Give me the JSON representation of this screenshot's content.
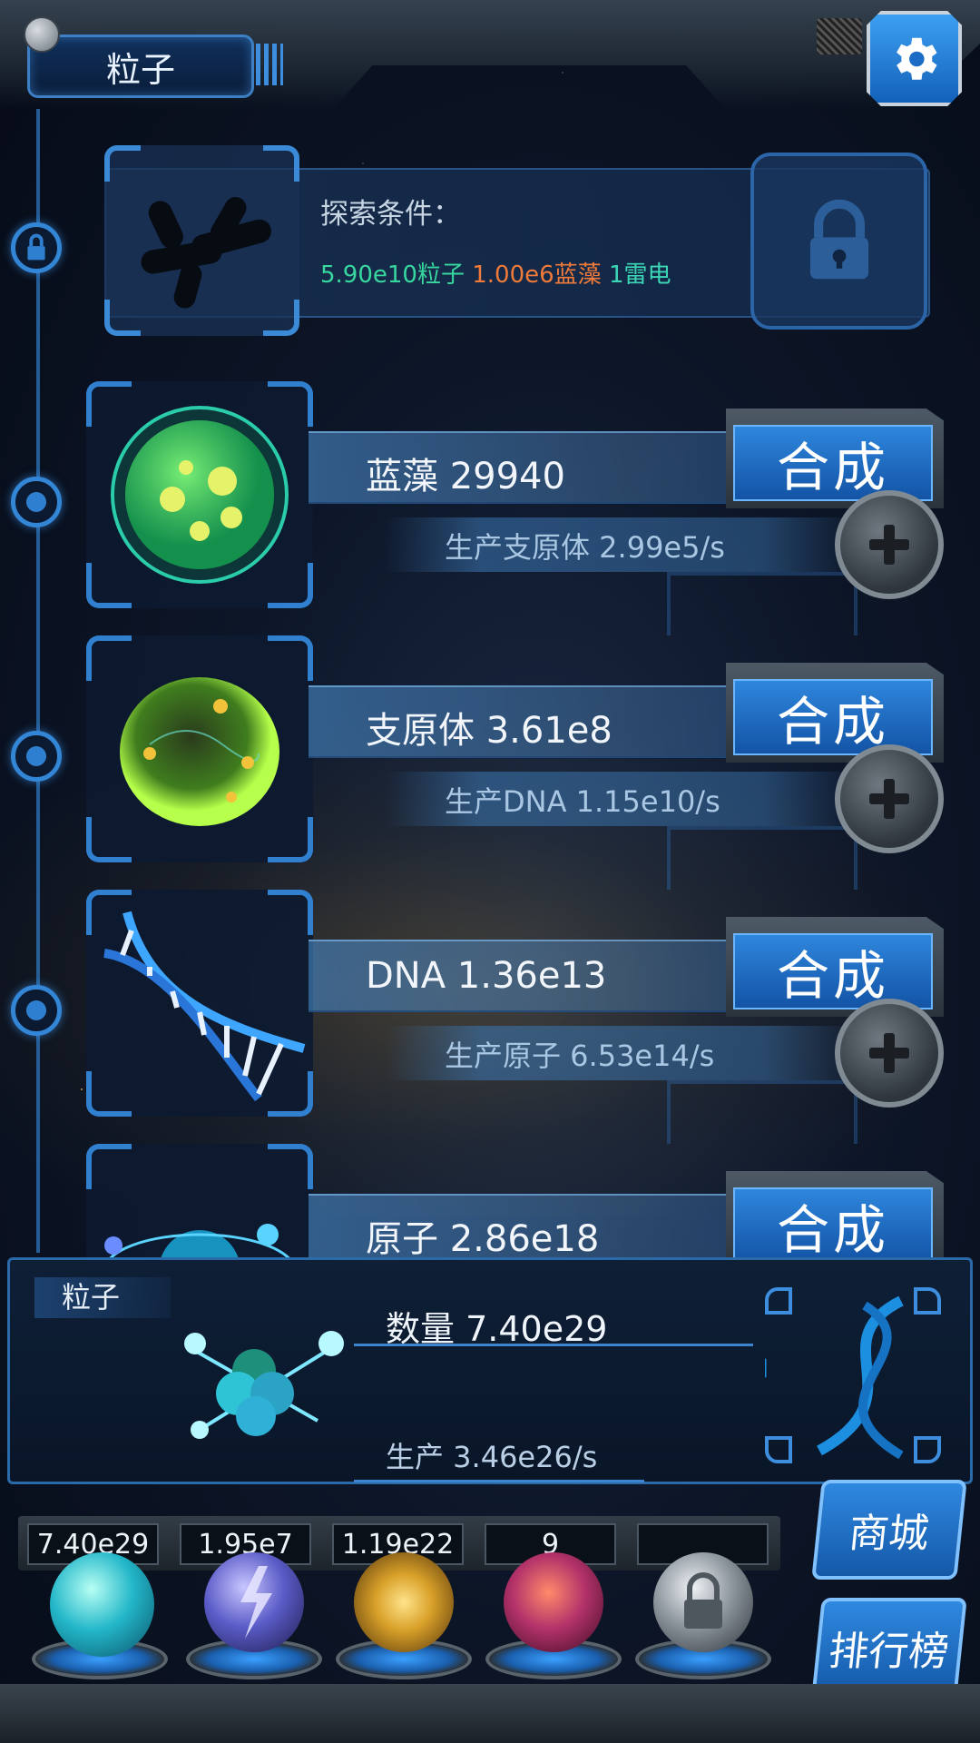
{
  "header": {
    "title": "粒子",
    "settings_icon": "gear-icon"
  },
  "explore": {
    "label": "探索条件：",
    "requirements": [
      {
        "text": "5.90e10粒子",
        "color": "#38d7a0"
      },
      {
        "text": "1.00e6蓝藻",
        "color": "#f07a3a"
      },
      {
        "text": "1雷电",
        "color": "#3dd6b4"
      }
    ],
    "lock_icon": "lock-icon"
  },
  "items": [
    {
      "name": "蓝藻 29940",
      "production": "生产支原体 2.99e5/s",
      "craft_label": "合成",
      "icon": "cyanobacteria-icon"
    },
    {
      "name": "支原体 3.61e8",
      "production": "生产DNA 1.15e10/s",
      "craft_label": "合成",
      "icon": "mycoplasma-icon"
    },
    {
      "name": "DNA 1.36e13",
      "production": "生产原子 6.53e14/s",
      "craft_label": "合成",
      "icon": "dna-icon"
    },
    {
      "name": "原子 2.86e18",
      "production": "",
      "craft_label": "合成",
      "icon": "atom-icon"
    }
  ],
  "summary": {
    "tab_label": "粒子",
    "count": "数量 7.40e29",
    "production": "生产 3.46e26/s"
  },
  "resources": [
    {
      "value": "7.40e29",
      "icon": "particle-orb-icon",
      "color": "#23b7c9"
    },
    {
      "value": "1.95e7",
      "icon": "lightning-orb-icon",
      "color": "#5b5cc8"
    },
    {
      "value": "1.19e22",
      "icon": "nebula-orb-icon",
      "color": "#d9a12a"
    },
    {
      "value": "9",
      "icon": "brain-orb-icon",
      "color": "#b3326a"
    },
    {
      "value": "",
      "icon": "locked-orb-icon",
      "color": "#8c949c"
    }
  ],
  "side_buttons": {
    "shop": "商城",
    "ranking": "排行榜"
  }
}
